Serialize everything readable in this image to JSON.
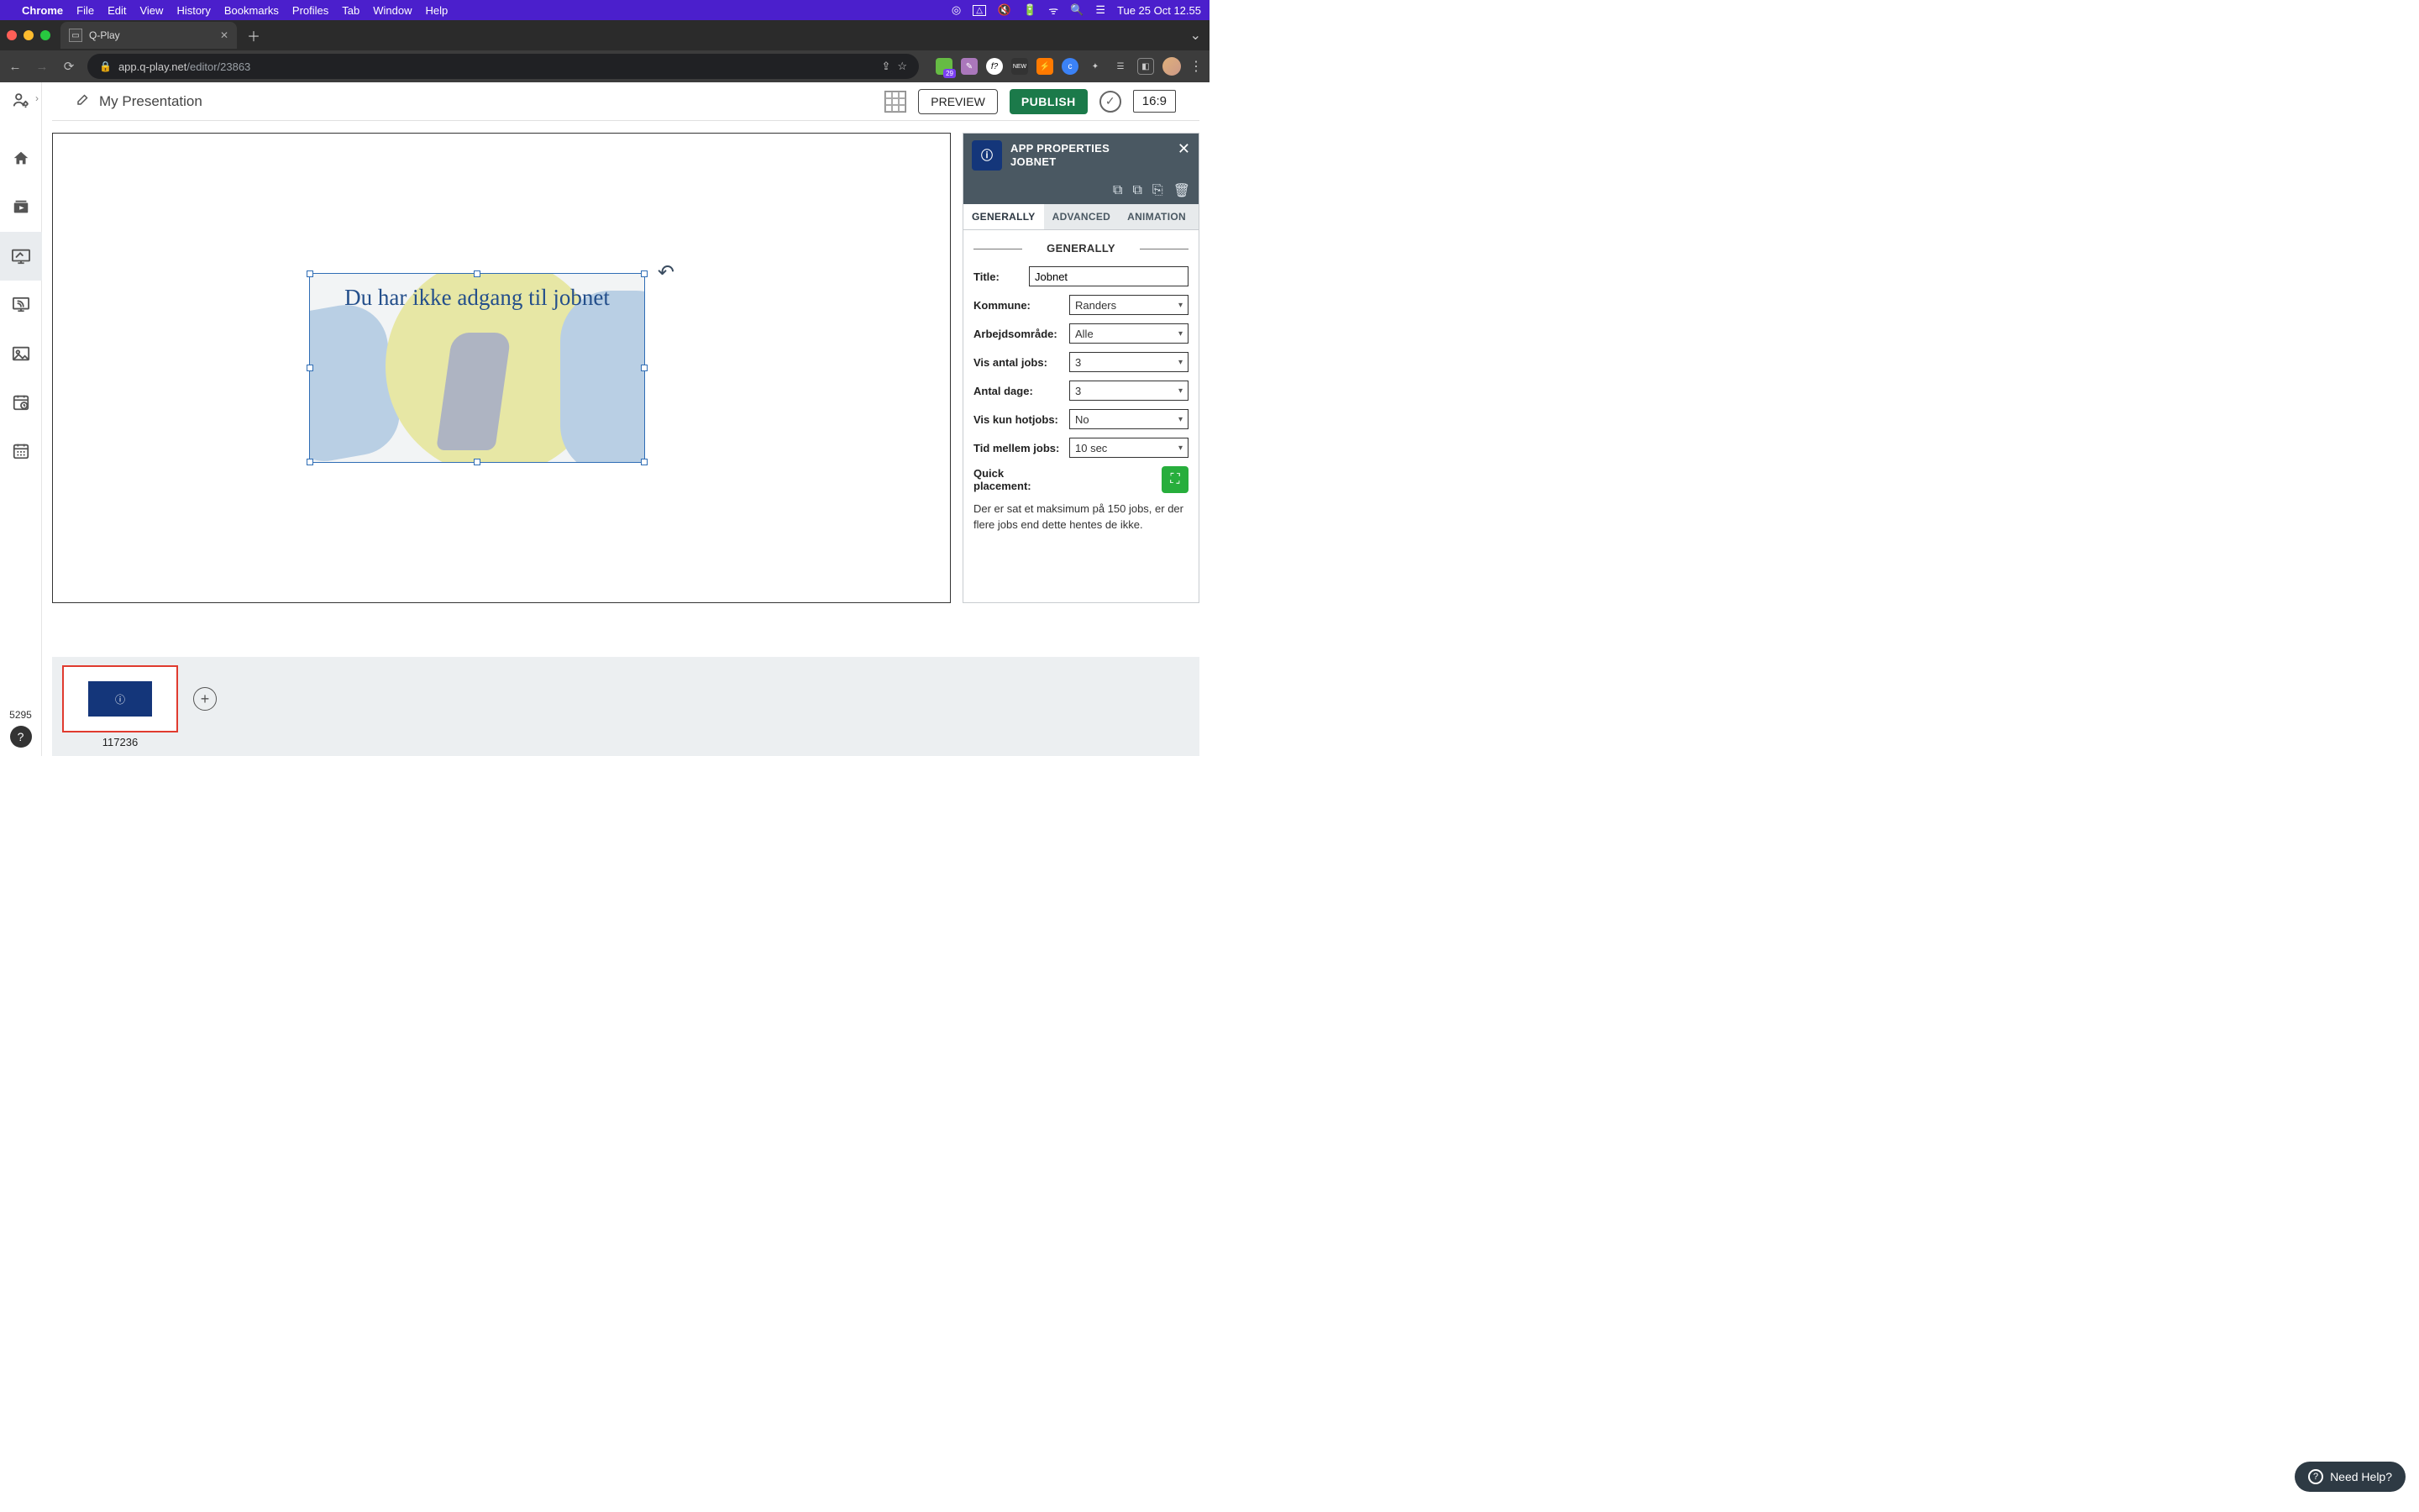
{
  "menubar": {
    "app": "Chrome",
    "items": [
      "File",
      "Edit",
      "View",
      "History",
      "Bookmarks",
      "Profiles",
      "Tab",
      "Window",
      "Help"
    ],
    "clock": "Tue 25 Oct  12.55"
  },
  "browser": {
    "tab_title": "Q-Play",
    "url_host": "app.q-play.net",
    "url_path": "/editor/23863",
    "ext_badge": "29",
    "ext_new": "NEW"
  },
  "apptop": {
    "presentation_name": "My Presentation",
    "preview": "PREVIEW",
    "publish": "PUBLISH",
    "ratio": "16:9"
  },
  "canvas": {
    "widget_text": "Du har ikke adgang til jobnet"
  },
  "panel": {
    "title1": "APP PROPERTIES",
    "title2": "JOBNET",
    "tabs": {
      "generally": "GENERALLY",
      "advanced": "ADVANCED",
      "animation": "ANIMATION"
    },
    "section": "GENERALLY",
    "fields": {
      "title_label": "Title:",
      "title_value": "Jobnet",
      "kommune_label": "Kommune:",
      "kommune_value": "Randers",
      "arbejds_label": "Arbejdsområde:",
      "arbejds_value": "Alle",
      "visantal_label": "Vis antal jobs:",
      "visantal_value": "3",
      "antaldage_label": "Antal dage:",
      "antaldage_value": "3",
      "hotjobs_label": "Vis kun hotjobs:",
      "hotjobs_value": "No",
      "tid_label": "Tid mellem jobs:",
      "tid_value": "10 sec",
      "quick_label": "Quick placement:"
    },
    "note": "Der er sat et maksimum på 150 jobs, er der flere jobs end dette hentes de ikke."
  },
  "strip": {
    "slide_id": "117236"
  },
  "leftcol": {
    "bottom_number": "5295"
  },
  "needhelp": "Need Help?"
}
